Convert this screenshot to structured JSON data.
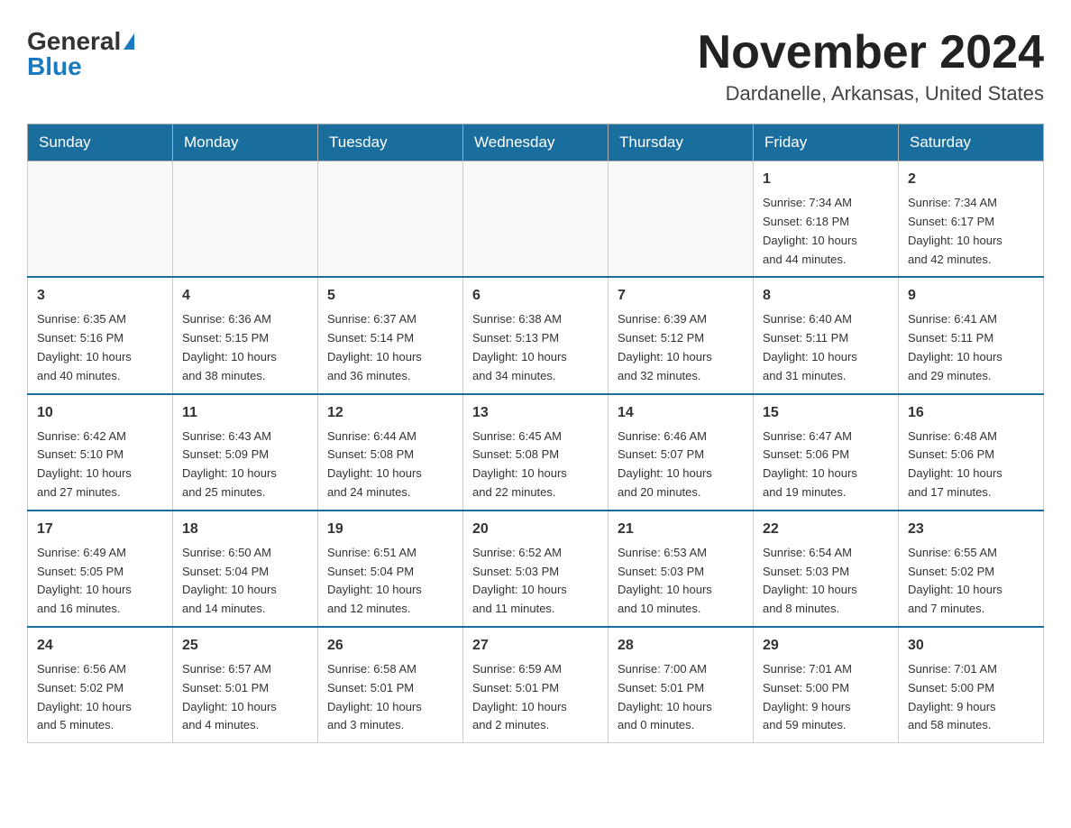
{
  "header": {
    "logo_general": "General",
    "logo_blue": "Blue",
    "month_title": "November 2024",
    "location": "Dardanelle, Arkansas, United States"
  },
  "days_of_week": [
    "Sunday",
    "Monday",
    "Tuesday",
    "Wednesday",
    "Thursday",
    "Friday",
    "Saturday"
  ],
  "weeks": [
    {
      "days": [
        {
          "num": "",
          "info": ""
        },
        {
          "num": "",
          "info": ""
        },
        {
          "num": "",
          "info": ""
        },
        {
          "num": "",
          "info": ""
        },
        {
          "num": "",
          "info": ""
        },
        {
          "num": "1",
          "info": "Sunrise: 7:34 AM\nSunset: 6:18 PM\nDaylight: 10 hours\nand 44 minutes."
        },
        {
          "num": "2",
          "info": "Sunrise: 7:34 AM\nSunset: 6:17 PM\nDaylight: 10 hours\nand 42 minutes."
        }
      ]
    },
    {
      "days": [
        {
          "num": "3",
          "info": "Sunrise: 6:35 AM\nSunset: 5:16 PM\nDaylight: 10 hours\nand 40 minutes."
        },
        {
          "num": "4",
          "info": "Sunrise: 6:36 AM\nSunset: 5:15 PM\nDaylight: 10 hours\nand 38 minutes."
        },
        {
          "num": "5",
          "info": "Sunrise: 6:37 AM\nSunset: 5:14 PM\nDaylight: 10 hours\nand 36 minutes."
        },
        {
          "num": "6",
          "info": "Sunrise: 6:38 AM\nSunset: 5:13 PM\nDaylight: 10 hours\nand 34 minutes."
        },
        {
          "num": "7",
          "info": "Sunrise: 6:39 AM\nSunset: 5:12 PM\nDaylight: 10 hours\nand 32 minutes."
        },
        {
          "num": "8",
          "info": "Sunrise: 6:40 AM\nSunset: 5:11 PM\nDaylight: 10 hours\nand 31 minutes."
        },
        {
          "num": "9",
          "info": "Sunrise: 6:41 AM\nSunset: 5:11 PM\nDaylight: 10 hours\nand 29 minutes."
        }
      ]
    },
    {
      "days": [
        {
          "num": "10",
          "info": "Sunrise: 6:42 AM\nSunset: 5:10 PM\nDaylight: 10 hours\nand 27 minutes."
        },
        {
          "num": "11",
          "info": "Sunrise: 6:43 AM\nSunset: 5:09 PM\nDaylight: 10 hours\nand 25 minutes."
        },
        {
          "num": "12",
          "info": "Sunrise: 6:44 AM\nSunset: 5:08 PM\nDaylight: 10 hours\nand 24 minutes."
        },
        {
          "num": "13",
          "info": "Sunrise: 6:45 AM\nSunset: 5:08 PM\nDaylight: 10 hours\nand 22 minutes."
        },
        {
          "num": "14",
          "info": "Sunrise: 6:46 AM\nSunset: 5:07 PM\nDaylight: 10 hours\nand 20 minutes."
        },
        {
          "num": "15",
          "info": "Sunrise: 6:47 AM\nSunset: 5:06 PM\nDaylight: 10 hours\nand 19 minutes."
        },
        {
          "num": "16",
          "info": "Sunrise: 6:48 AM\nSunset: 5:06 PM\nDaylight: 10 hours\nand 17 minutes."
        }
      ]
    },
    {
      "days": [
        {
          "num": "17",
          "info": "Sunrise: 6:49 AM\nSunset: 5:05 PM\nDaylight: 10 hours\nand 16 minutes."
        },
        {
          "num": "18",
          "info": "Sunrise: 6:50 AM\nSunset: 5:04 PM\nDaylight: 10 hours\nand 14 minutes."
        },
        {
          "num": "19",
          "info": "Sunrise: 6:51 AM\nSunset: 5:04 PM\nDaylight: 10 hours\nand 12 minutes."
        },
        {
          "num": "20",
          "info": "Sunrise: 6:52 AM\nSunset: 5:03 PM\nDaylight: 10 hours\nand 11 minutes."
        },
        {
          "num": "21",
          "info": "Sunrise: 6:53 AM\nSunset: 5:03 PM\nDaylight: 10 hours\nand 10 minutes."
        },
        {
          "num": "22",
          "info": "Sunrise: 6:54 AM\nSunset: 5:03 PM\nDaylight: 10 hours\nand 8 minutes."
        },
        {
          "num": "23",
          "info": "Sunrise: 6:55 AM\nSunset: 5:02 PM\nDaylight: 10 hours\nand 7 minutes."
        }
      ]
    },
    {
      "days": [
        {
          "num": "24",
          "info": "Sunrise: 6:56 AM\nSunset: 5:02 PM\nDaylight: 10 hours\nand 5 minutes."
        },
        {
          "num": "25",
          "info": "Sunrise: 6:57 AM\nSunset: 5:01 PM\nDaylight: 10 hours\nand 4 minutes."
        },
        {
          "num": "26",
          "info": "Sunrise: 6:58 AM\nSunset: 5:01 PM\nDaylight: 10 hours\nand 3 minutes."
        },
        {
          "num": "27",
          "info": "Sunrise: 6:59 AM\nSunset: 5:01 PM\nDaylight: 10 hours\nand 2 minutes."
        },
        {
          "num": "28",
          "info": "Sunrise: 7:00 AM\nSunset: 5:01 PM\nDaylight: 10 hours\nand 0 minutes."
        },
        {
          "num": "29",
          "info": "Sunrise: 7:01 AM\nSunset: 5:00 PM\nDaylight: 9 hours\nand 59 minutes."
        },
        {
          "num": "30",
          "info": "Sunrise: 7:01 AM\nSunset: 5:00 PM\nDaylight: 9 hours\nand 58 minutes."
        }
      ]
    }
  ]
}
